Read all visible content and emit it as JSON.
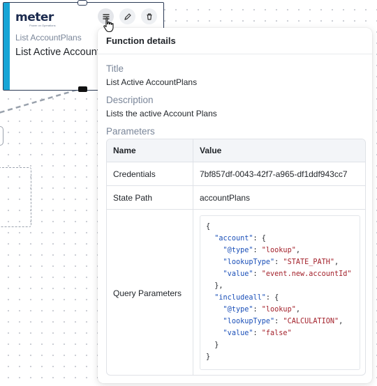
{
  "node": {
    "logo_text": "meter",
    "logo_tagline": "Power on Operations",
    "type_label": "List AccountPlans",
    "title": "List Active AccountPlans",
    "accent_color": "#17a5d6"
  },
  "toolbar": {
    "icons": [
      "menu-icon",
      "pencil-icon",
      "trash-icon"
    ]
  },
  "popover": {
    "header": "Function details",
    "title_label": "Title",
    "title_value": "List Active AccountPlans",
    "description_label": "Description",
    "description_value": "Lists the active Account Plans",
    "parameters_label": "Parameters",
    "columns": [
      "Name",
      "Value"
    ],
    "rows": [
      {
        "name": "Credentials",
        "value": "7bf857df-0043-42f7-a965-df1ddf943cc7"
      },
      {
        "name": "State Path",
        "value": "accountPlans"
      },
      {
        "name": "Query Parameters",
        "value": ""
      }
    ],
    "query_parameters": {
      "account": {
        "@type": "lookup",
        "lookupType": "STATE_PATH",
        "value": "event.new.accountId"
      },
      "includeall": {
        "@type": "lookup",
        "lookupType": "CALCULATION",
        "value": "false"
      }
    }
  }
}
